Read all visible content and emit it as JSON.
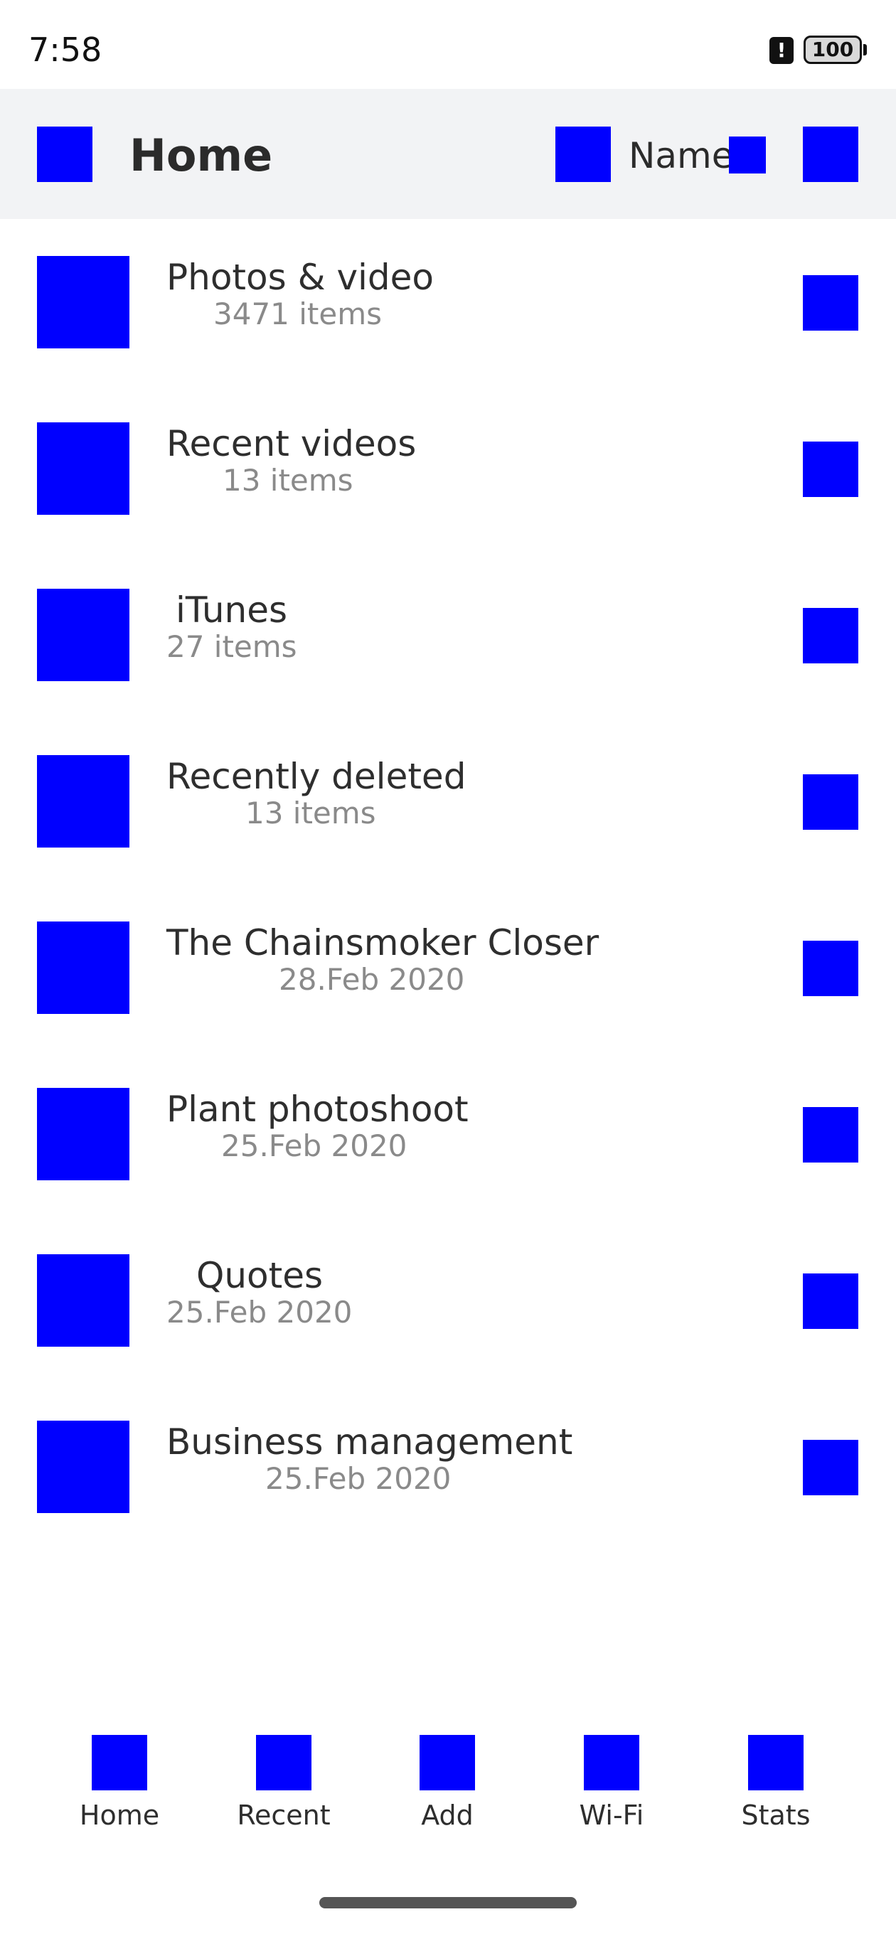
{
  "status_bar": {
    "time": "7:58",
    "alert_icon": "!",
    "battery": "100"
  },
  "header": {
    "title": "Home",
    "sort_label": "Name"
  },
  "items": [
    {
      "title": "Photos & video",
      "subtitle": "3471 items"
    },
    {
      "title": "Recent videos",
      "subtitle": "13 items"
    },
    {
      "title": "iTunes",
      "subtitle": "27 items"
    },
    {
      "title": "Recently deleted",
      "subtitle": "13 items"
    },
    {
      "title": "The Chainsmoker Closer",
      "subtitle": "28.Feb 2020"
    },
    {
      "title": "Plant photoshoot",
      "subtitle": "25.Feb 2020"
    },
    {
      "title": "Quotes",
      "subtitle": "25.Feb 2020"
    },
    {
      "title": "Business management",
      "subtitle": "25.Feb 2020"
    }
  ],
  "bottom_nav": [
    {
      "label": "Home"
    },
    {
      "label": "Recent"
    },
    {
      "label": "Add"
    },
    {
      "label": "Wi-Fi"
    },
    {
      "label": "Stats"
    }
  ],
  "colors": {
    "placeholder": "#0000ff",
    "header_bg": "#f2f3f5",
    "text": "#2e2e2e",
    "subtext": "#8a8a8a"
  }
}
